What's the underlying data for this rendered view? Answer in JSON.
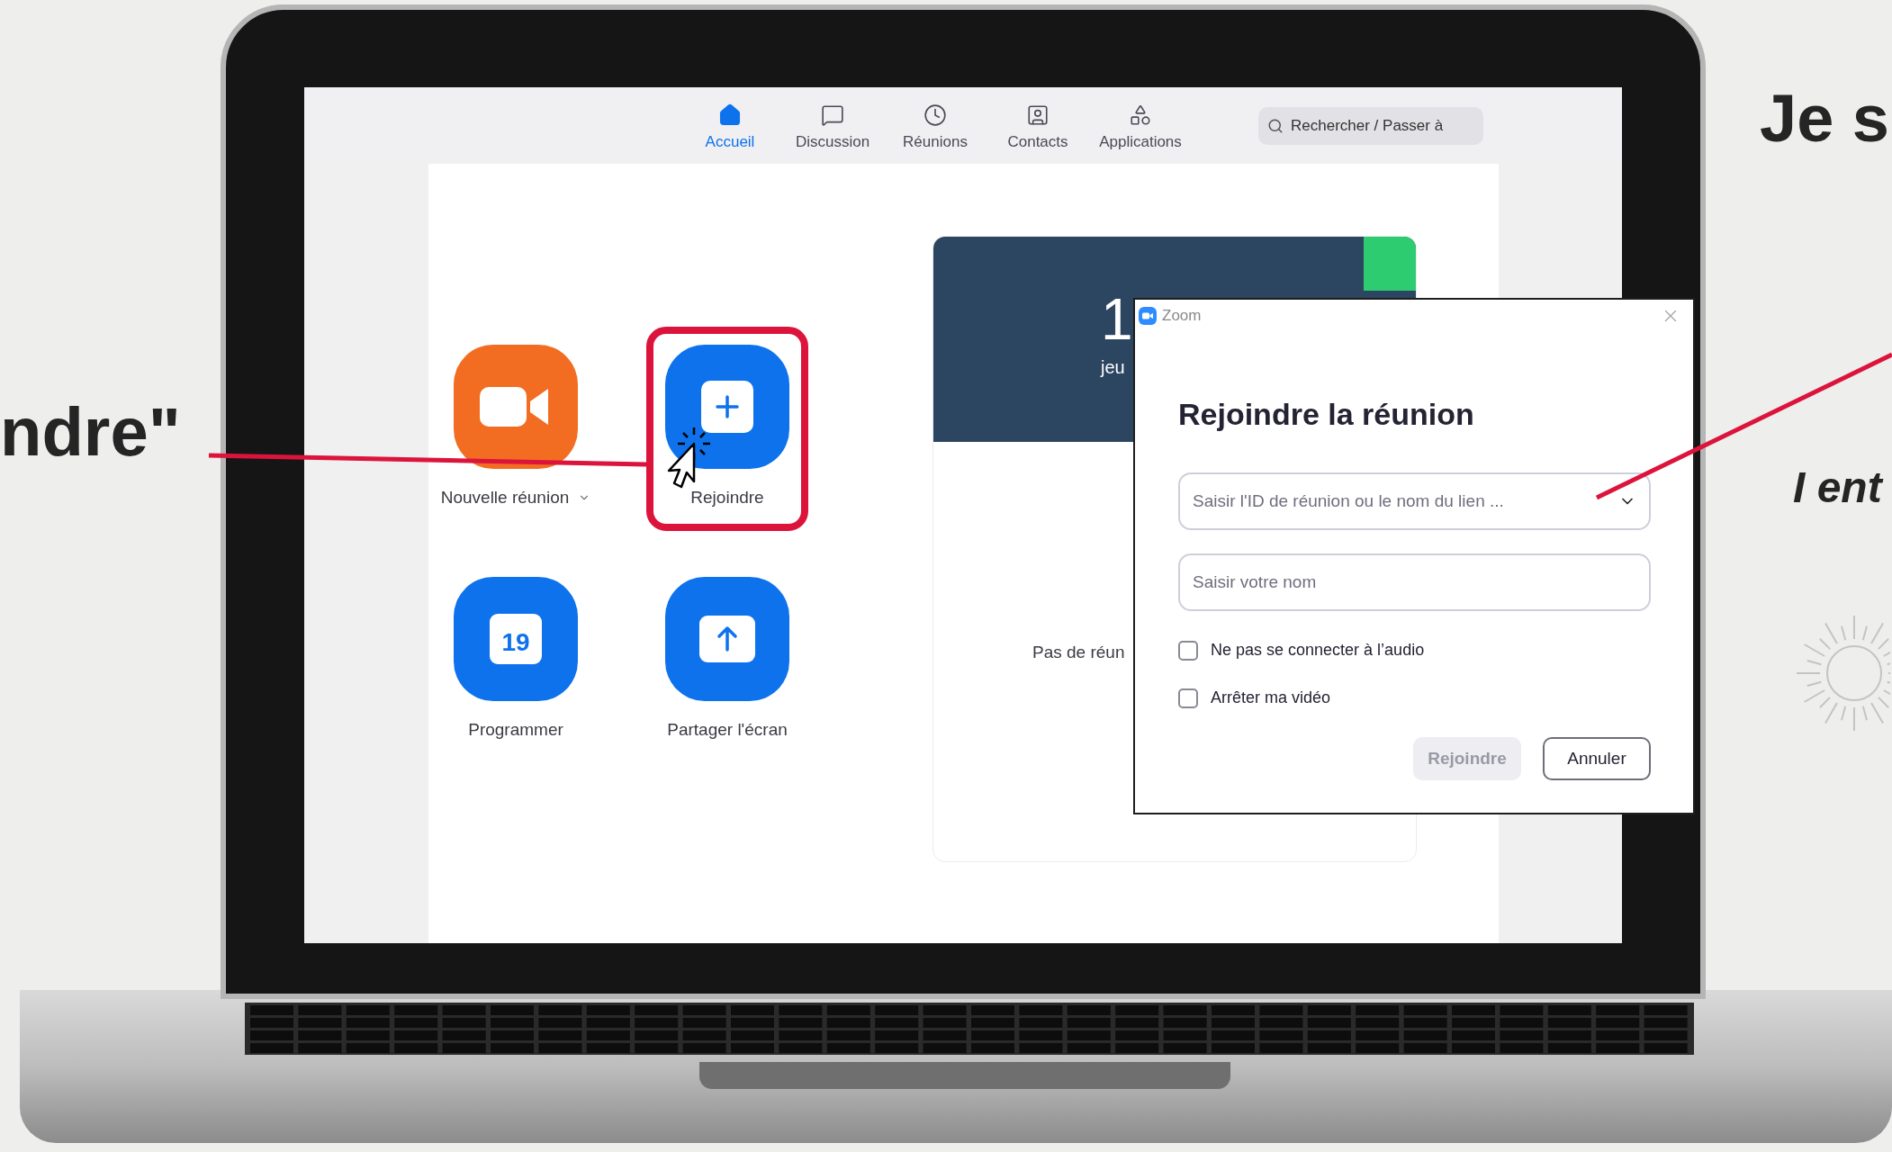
{
  "slide": {
    "heading_fragment": "Je s",
    "callout_fragment": "ndre\"",
    "caption_fragment": "I ent"
  },
  "app": {
    "nav_tabs": [
      {
        "label": "Accueil",
        "kind": "home",
        "selected": true
      },
      {
        "label": "Discussion",
        "kind": "chat",
        "selected": false
      },
      {
        "label": "Réunions",
        "kind": "clock",
        "selected": false
      },
      {
        "label": "Contacts",
        "kind": "contact",
        "selected": false
      },
      {
        "label": "Applications",
        "kind": "apps",
        "selected": false
      }
    ],
    "search": {
      "placeholder": "Rechercher / Passer à"
    },
    "actions": [
      {
        "label": "Nouvelle réunion",
        "kind": "video",
        "color": "#f26d21",
        "dropdown": true,
        "highlighted": false
      },
      {
        "label": "Rejoindre",
        "kind": "plus",
        "color": "#0e72ed",
        "dropdown": false,
        "highlighted": true
      },
      {
        "label": "Programmer",
        "kind": "calendar",
        "icon_text": "19",
        "color": "#0e72ed",
        "dropdown": false,
        "highlighted": false
      },
      {
        "label": "Partager l'écran",
        "kind": "share",
        "color": "#0e72ed",
        "dropdown": false,
        "highlighted": false
      }
    ],
    "card": {
      "day_fragment": "1",
      "date_fragment": "jeu",
      "empty_fragment": "Pas de réun"
    }
  },
  "dialog": {
    "title": "Zoom",
    "heading": "Rejoindre la réunion",
    "meeting_field": {
      "placeholder": "Saisir l'ID de réunion ou le nom du lien ..."
    },
    "name_field": {
      "placeholder": "Saisir votre nom"
    },
    "options": [
      {
        "label": "Ne pas se connecter à l’audio",
        "checked": false
      },
      {
        "label": "Arrêter ma vidéo",
        "checked": false
      }
    ],
    "buttons": [
      {
        "label": "Rejoindre",
        "disabled": true
      },
      {
        "label": "Annuler",
        "disabled": false
      }
    ]
  }
}
